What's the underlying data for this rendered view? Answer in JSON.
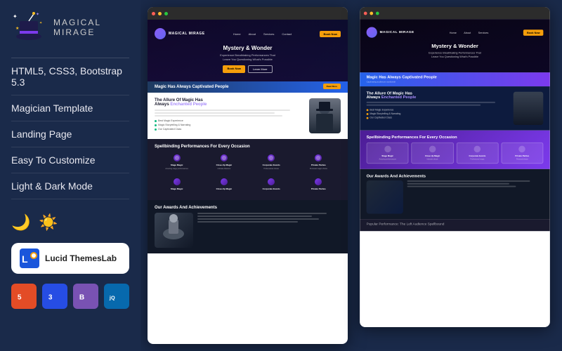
{
  "brand": {
    "name": "MAGICAL",
    "tagline": "MIRAGE"
  },
  "features": [
    "HTML5, CSS3, Bootstrap 5.3",
    "Magician Template",
    "Landing Page",
    "Easy To Customize",
    "Light & Dark Mode"
  ],
  "modes": {
    "dark_icon": "🌙",
    "light_icon": "☀️"
  },
  "lucid": {
    "name": "Lucid ThemesLab"
  },
  "tech": [
    {
      "label": "5",
      "name": "HTML5"
    },
    {
      "label": "3",
      "name": "CSS3"
    },
    {
      "label": "B",
      "name": "Bootstrap"
    },
    {
      "label": "jQ",
      "name": "jQuery"
    }
  ],
  "preview": {
    "hero_title": "Mystery & Wonder",
    "hero_sub": "Experience Breathtaking Performances That\nLeave You Questioning What's Possible",
    "section1_title": "Magic Has Always Captivated People",
    "section2_title": "The Allure Of Magic Has Always Enchanted People",
    "section3_title": "Spellbinding Performances For Every Occasion",
    "section4_title": "Our Awards And Achievements",
    "list_items": [
      "Best Magic Experience",
      "Magic Storytelling & Narrating",
      "Our Captivated Class"
    ],
    "services": [
      {
        "name": "Stage Magic",
        "desc": "Captivating performances"
      },
      {
        "name": "Close-Up Magic",
        "desc": "Intimate illusions"
      },
      {
        "name": "Corporate Events",
        "desc": "Professional magic"
      },
      {
        "name": "Private Parties",
        "desc": "Personal magic shows"
      }
    ],
    "nav_links": [
      "Home",
      "About",
      "Services",
      "Contact"
    ]
  }
}
